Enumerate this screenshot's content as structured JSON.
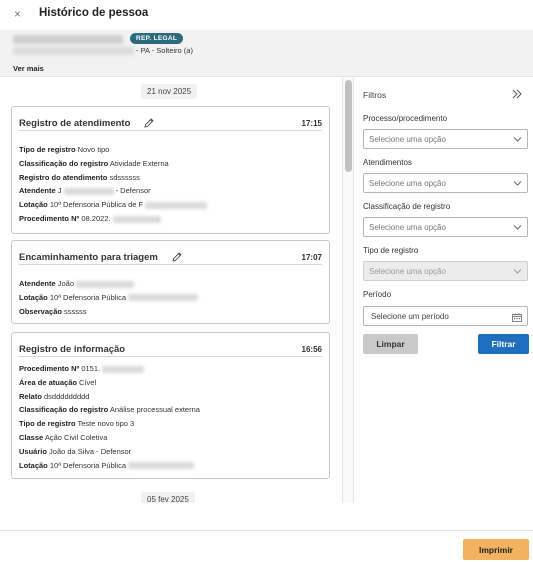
{
  "header": {
    "close_glyph": "×",
    "title": "Histórico de pessoa"
  },
  "person": {
    "badge": "REP. LEGAL",
    "details": "- PA - Solteiro (a)",
    "more_link": "Ver mais"
  },
  "timeline": {
    "dates": [
      "21 nov 2025",
      "05 fev 2025"
    ],
    "cards": [
      {
        "title": "Registro de atendimento",
        "time": "17:15",
        "editable": true,
        "rows": [
          {
            "label": "Tipo de registro",
            "value": "Novo tipo"
          },
          {
            "label": "Classificação do registro",
            "value": "Atividade Externa"
          },
          {
            "label": "Registro do atendimento",
            "value": "sdssssss"
          },
          {
            "label": "Atendente",
            "value": "J",
            "suffix": " - Defensor"
          },
          {
            "label": "Lotação",
            "value": "10ª Defensoria Pública de F"
          },
          {
            "label": "Procedimento Nº",
            "value": "08.2022."
          }
        ]
      },
      {
        "title": "Encaminhamento para triagem",
        "time": "17:07",
        "editable": true,
        "rows": [
          {
            "label": "Atendente",
            "value": "João"
          },
          {
            "label": "Lotação",
            "value": "10ª Defensoria Pública"
          },
          {
            "label": "Observação",
            "value": "ssssss"
          }
        ]
      },
      {
        "title": "Registro de informação",
        "time": "16:56",
        "editable": false,
        "rows": [
          {
            "label": "Procedimento Nº",
            "value": "0151."
          },
          {
            "label": "Área de atuação",
            "value": "Cível"
          },
          {
            "label": "Relato",
            "value": "dsddddddddd"
          },
          {
            "label": "Classificação do registro",
            "value": "Análise processual externa"
          },
          {
            "label": "Tipo de registro",
            "value": "Teste novo tipo 3"
          },
          {
            "label": "Classe",
            "value": "Ação Civil Coletiva"
          },
          {
            "label": "Usuário",
            "value": "João da Silva - Defensor"
          },
          {
            "label": "Lotação",
            "value": "10ª Defensoria Pública"
          }
        ]
      }
    ]
  },
  "filters": {
    "title": "Filtros",
    "fields": [
      {
        "label": "Processo/procedimento",
        "placeholder": "Selecione uma opção",
        "disabled": false
      },
      {
        "label": "Atendimentos",
        "placeholder": "Selecione uma opção",
        "disabled": false
      },
      {
        "label": "Classificação de registro",
        "placeholder": "Selecione uma opção",
        "disabled": false
      },
      {
        "label": "Tipo de registro",
        "placeholder": "Selecione uma opção",
        "disabled": true
      }
    ],
    "period": {
      "label": "Período",
      "placeholder": "Selecione um período"
    },
    "clear_label": "Limpar",
    "apply_label": "Filtrar"
  },
  "footer": {
    "print_label": "Imprimir"
  },
  "colors": {
    "badge": "#2c6a80",
    "primary": "#1f6fbf",
    "print": "#f3b260",
    "clear": "#c9c9c9"
  },
  "icons": [
    "close-icon",
    "edit-pencil-icon",
    "double-chevron-right-icon",
    "chevron-down-icon",
    "calendar-icon"
  ]
}
